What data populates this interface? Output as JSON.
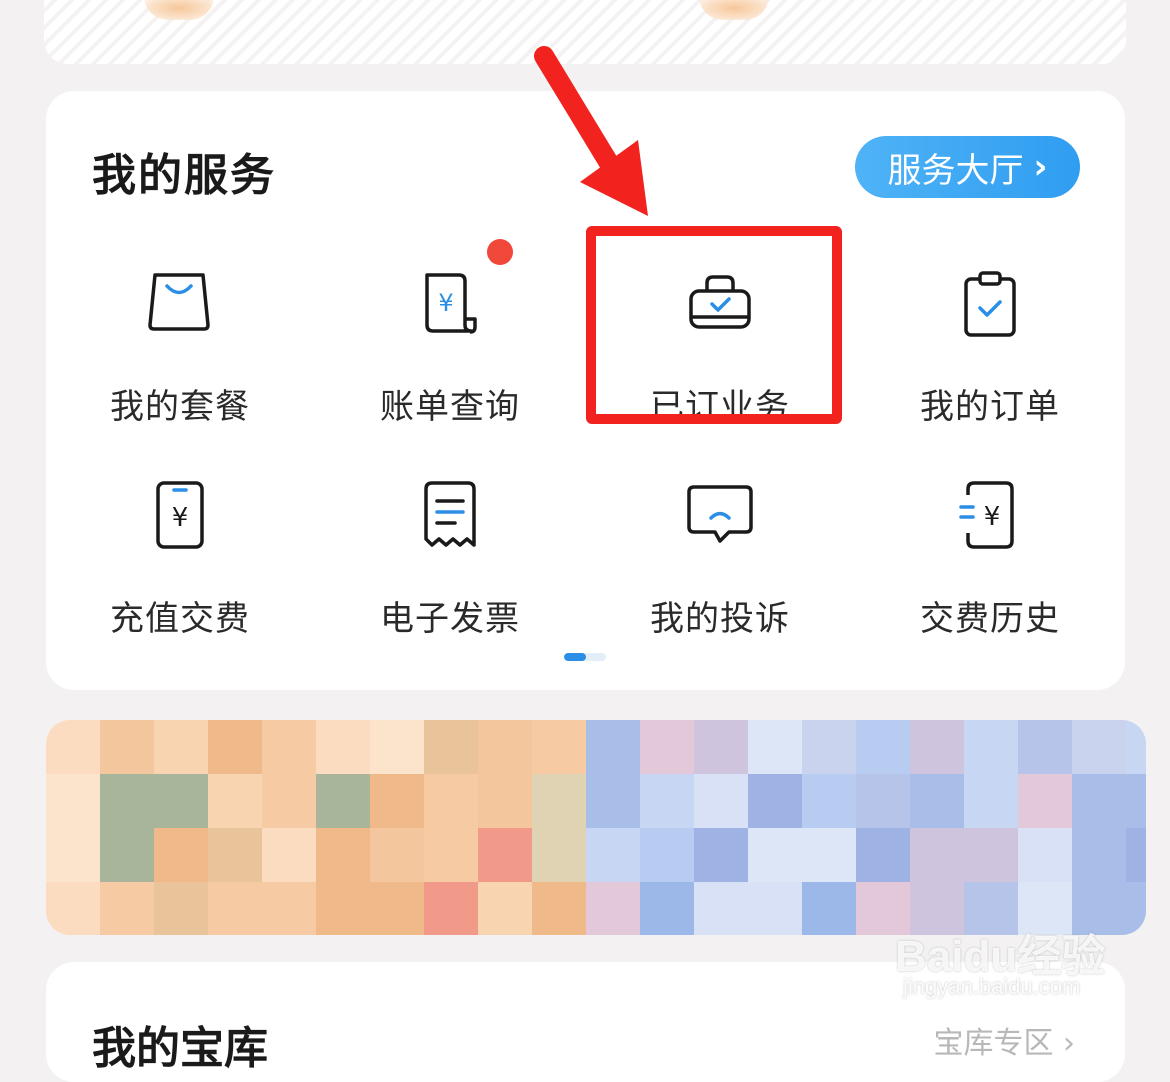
{
  "services": {
    "title": "我的服务",
    "hall_button": "服务大厅",
    "items": [
      {
        "label": "我的套餐",
        "icon": "shopping-bag-icon"
      },
      {
        "label": "账单查询",
        "icon": "bill-receipt-icon",
        "badge": true
      },
      {
        "label": "已订业务",
        "icon": "subscribed-bag-check-icon",
        "highlighted": true
      },
      {
        "label": "我的订单",
        "icon": "clipboard-check-icon"
      },
      {
        "label": "充值交费",
        "icon": "phone-yuan-icon"
      },
      {
        "label": "电子发票",
        "icon": "invoice-icon"
      },
      {
        "label": "我的投诉",
        "icon": "complaint-chat-icon"
      },
      {
        "label": "交费历史",
        "icon": "payment-history-icon"
      }
    ],
    "pager": {
      "pages": 2,
      "current": 1
    }
  },
  "bottom_section": {
    "title": "我的宝库",
    "link": "宝库专区"
  },
  "watermark": {
    "main": "Baidu经验",
    "sub": "jingyan.baidu.com"
  },
  "colors": {
    "accent_blue": "#2f9df1",
    "highlight_red": "#f2221e",
    "badge_red": "#f0493c",
    "icon_stroke": "#1a1a1a",
    "icon_accent": "#2a8ee6"
  }
}
